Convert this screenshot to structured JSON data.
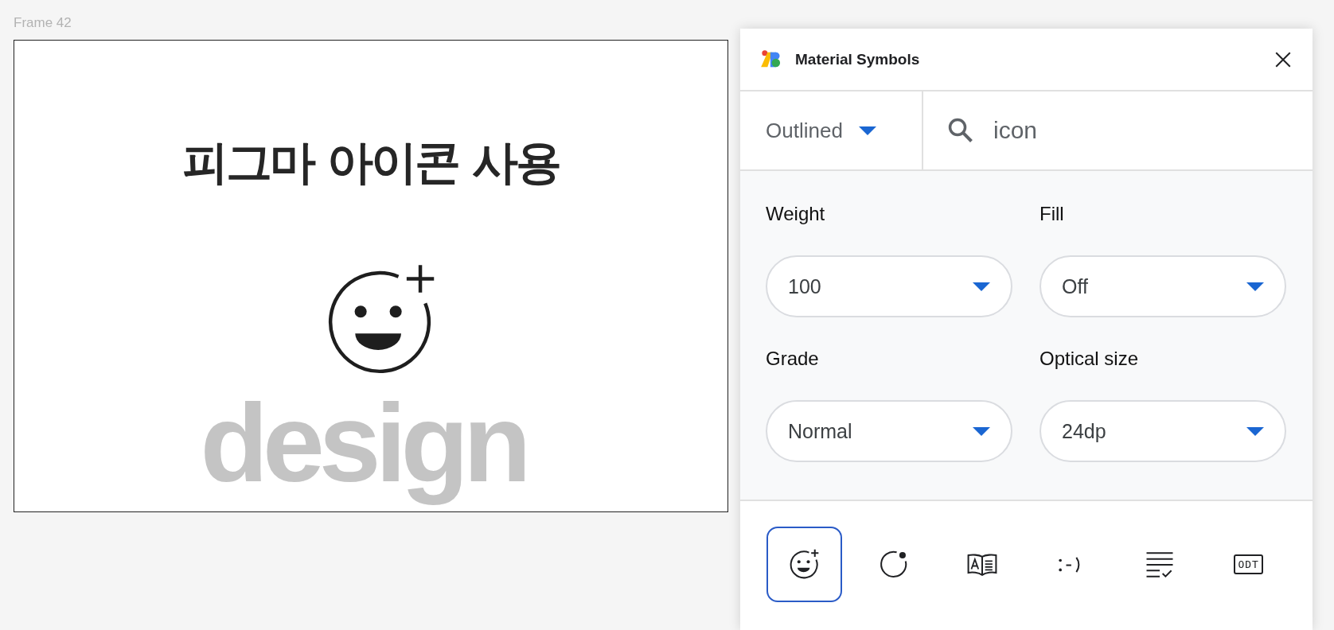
{
  "canvas": {
    "frame_label": "Frame 42",
    "frame": {
      "title": "피그마 아이콘 사용",
      "background_text": "design"
    }
  },
  "plugin": {
    "title": "Material Symbols",
    "style_select": {
      "value": "Outlined"
    },
    "search": {
      "value": "icon"
    },
    "settings": [
      {
        "label": "Weight",
        "value": "100"
      },
      {
        "label": "Fill",
        "value": "Off"
      },
      {
        "label": "Grade",
        "value": "Normal"
      },
      {
        "label": "Optical size",
        "value": "24dp"
      }
    ],
    "icons": [
      {
        "kind": "smiley-plus",
        "selected": true
      },
      {
        "kind": "circle-dot",
        "selected": false
      },
      {
        "kind": "book",
        "selected": false
      },
      {
        "kind": "emoticon",
        "selected": false
      },
      {
        "kind": "checklist",
        "selected": false
      },
      {
        "kind": "odt",
        "selected": false,
        "label": "ODT"
      }
    ]
  }
}
